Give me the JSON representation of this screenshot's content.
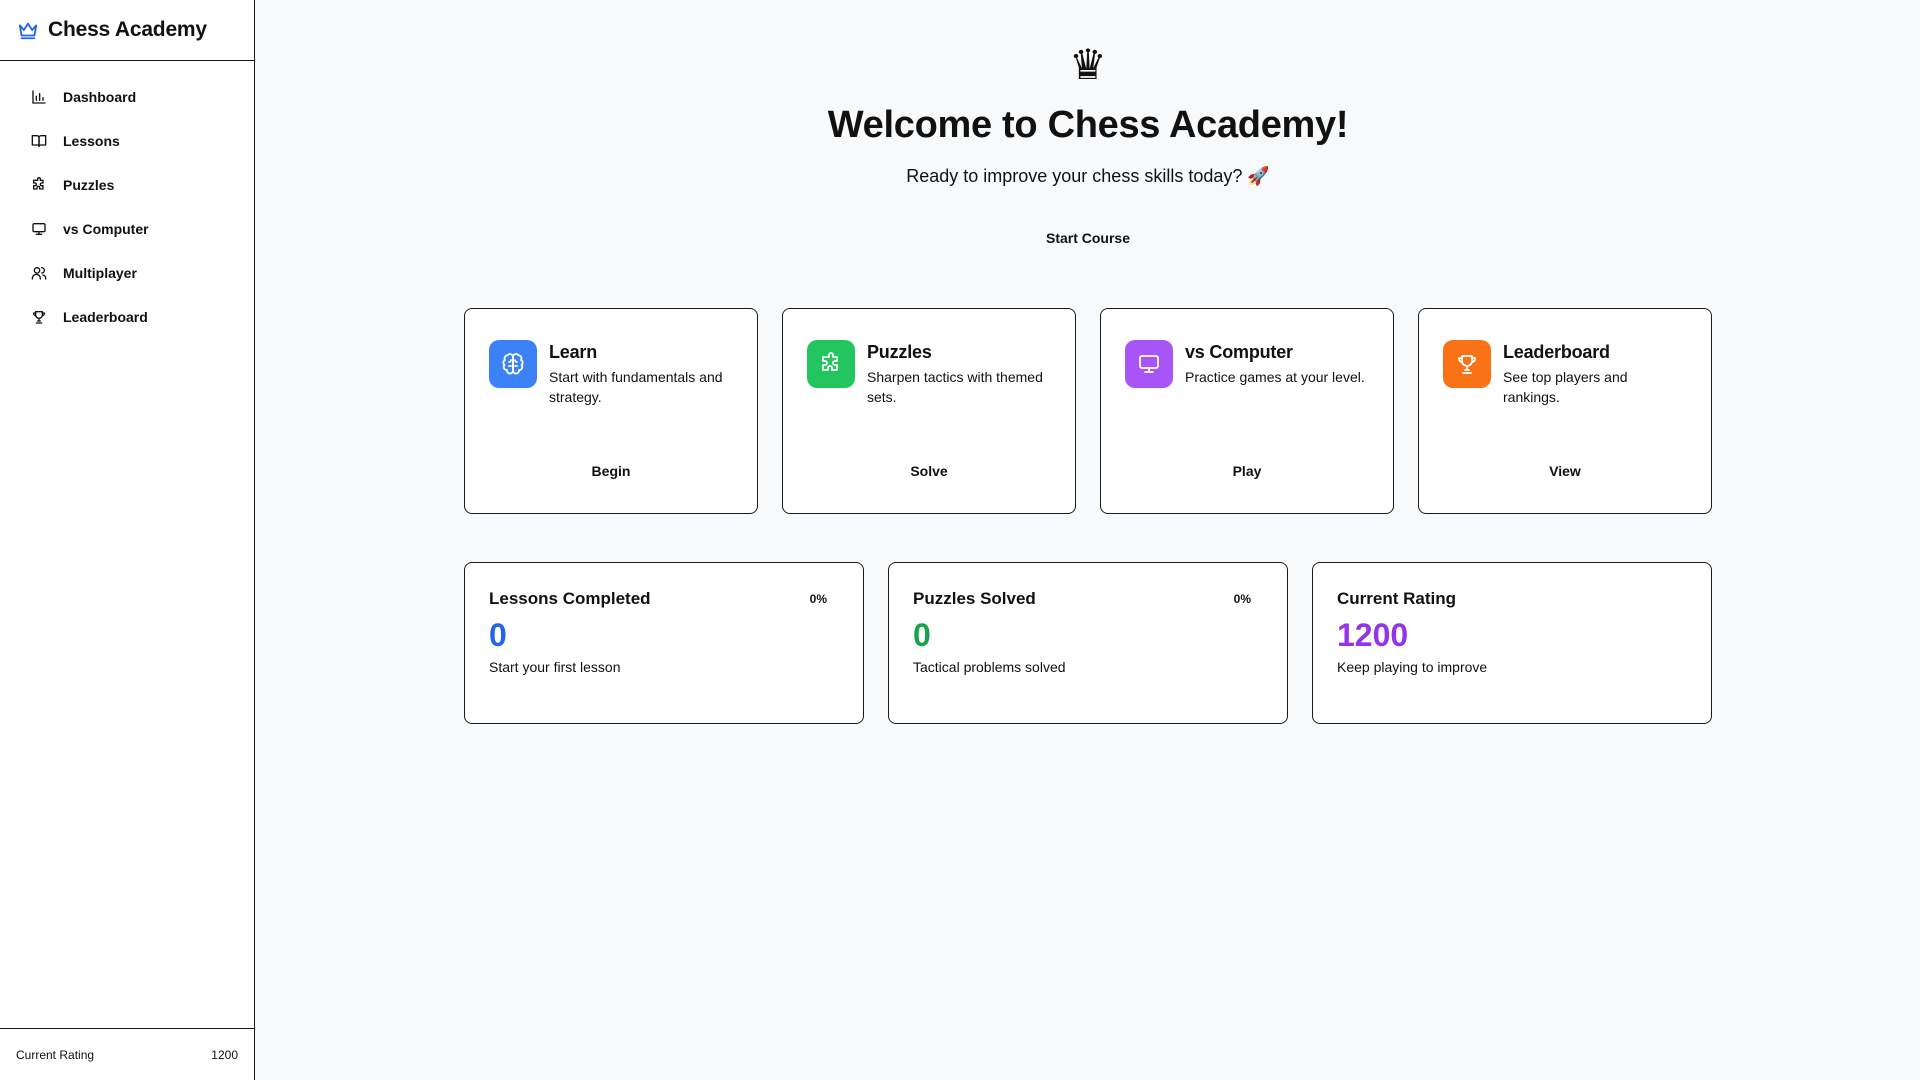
{
  "app": {
    "title": "Chess Academy"
  },
  "sidebar": {
    "items": [
      {
        "label": "Dashboard",
        "icon": "bar-chart-icon"
      },
      {
        "label": "Lessons",
        "icon": "book-icon"
      },
      {
        "label": "Puzzles",
        "icon": "puzzle-icon"
      },
      {
        "label": "vs Computer",
        "icon": "monitor-icon"
      },
      {
        "label": "Multiplayer",
        "icon": "users-icon"
      },
      {
        "label": "Leaderboard",
        "icon": "trophy-icon"
      }
    ],
    "footer": {
      "label": "Current Rating",
      "value": "1200"
    }
  },
  "hero": {
    "icon": "♛",
    "title": "Welcome to Chess Academy!",
    "subtitle": "Ready to improve your chess skills today? 🚀",
    "cta": "Start Course"
  },
  "cards": [
    {
      "title": "Learn",
      "desc": "Start with fundamentals and strategy.",
      "button": "Begin",
      "color": "#3b82f6",
      "icon": "brain-icon"
    },
    {
      "title": "Puzzles",
      "desc": "Sharpen tactics with themed sets.",
      "button": "Solve",
      "color": "#22c55e",
      "icon": "puzzle-icon"
    },
    {
      "title": "vs Computer",
      "desc": "Practice games at your level.",
      "button": "Play",
      "color": "#a855f7",
      "icon": "monitor-icon"
    },
    {
      "title": "Leaderboard",
      "desc": "See top players and rankings.",
      "button": "View",
      "color": "#f97316",
      "icon": "trophy-icon"
    }
  ],
  "stats": [
    {
      "label": "Lessons Completed",
      "percent": "0%",
      "value": "0",
      "note": "Start your first lesson",
      "color": "#2563eb"
    },
    {
      "label": "Puzzles Solved",
      "percent": "0%",
      "value": "0",
      "note": "Tactical problems solved",
      "color": "#16a34a"
    },
    {
      "label": "Current Rating",
      "percent": "",
      "value": "1200",
      "note": "Keep playing to improve",
      "color": "#9333ea"
    }
  ]
}
